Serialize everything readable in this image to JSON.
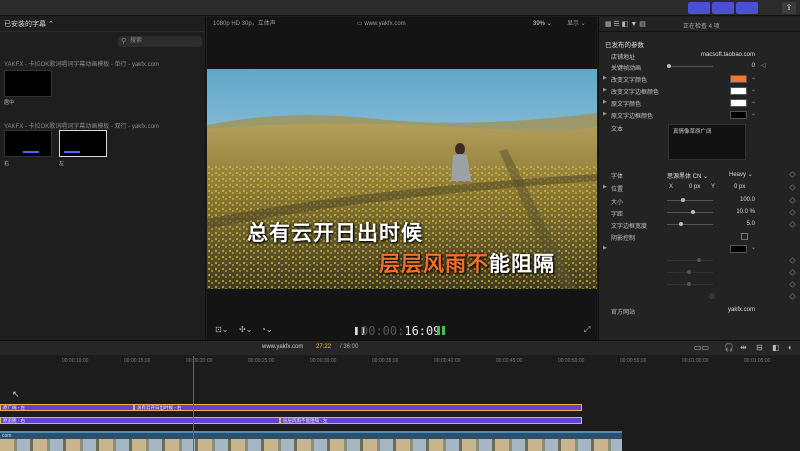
{
  "browser": {
    "header": "已安装的字幕",
    "search_placeholder": "搜索",
    "group1": "YAKFX - 卡拉OK歌词唱词字幕动画模板 - 单行 - yakfx.com",
    "group1_item": "居中",
    "group2": "YAKFX - 卡拉OK歌词唱词字幕动画模板 - 双行 - yakfx.com",
    "group2_items": [
      "右",
      "左"
    ]
  },
  "viewer": {
    "format": "1080p HD 30p，立体声",
    "site": "www.yakfx.com",
    "zoom": "39%",
    "display": "显示",
    "subtitle_line1": "总有云开日出时候",
    "subtitle_line2_highlight": "层层风雨不",
    "subtitle_line2_rest": "能阻隔",
    "timecode_dim": "00:00:",
    "timecode": "16:09"
  },
  "inspector": {
    "header": "正在检查 4 项",
    "section": "已发布的参数",
    "rows": [
      {
        "label": "店铺地址",
        "value": "macsoft.taobao.com"
      },
      {
        "label": "关键帧动画",
        "value": "0"
      },
      {
        "label": "改变文字颜色",
        "color": "#f07a2a"
      },
      {
        "label": "改变文字边框颜色",
        "color": "#ffffff"
      },
      {
        "label": "原文字颜色",
        "color": "#ffffff"
      },
      {
        "label": "原文字边框颜色",
        "color": "#000000"
      }
    ],
    "text_label": "文本",
    "text_value": "真情像草原广阔",
    "font_label": "字体",
    "font_value": "思源黑体 CN",
    "font_weight": "Heavy",
    "position_label": "位置",
    "pos_x_label": "X",
    "pos_x": "0",
    "pos_y_label": "Y",
    "pos_y": "0",
    "pos_unit": "px",
    "size_label": "大小",
    "size_value": "100.0",
    "spacing_label": "字距",
    "spacing_value": "10.0 %",
    "border_label": "文字边框宽度",
    "border_value": "5.0",
    "shadow_label": "阴影控制",
    "official_label": "官方网站",
    "official_value": "yakfx.com"
  },
  "timeline": {
    "site": "www.yakfx.com",
    "time": "27:22",
    "duration": "/ 36:00",
    "ticks": [
      "00:00:10:00",
      "00:00:15:00",
      "00:00:20:00",
      "00:00:25:00",
      "00:00:30:00",
      "00:00:35:00",
      "00:00:40:00",
      "00:00:45:00",
      "00:00:50:00",
      "00:00:55:00",
      "00:01:00:00",
      "00:01:05:00"
    ],
    "clips": [
      "原广阔 - 左",
      "总有云开日出时候 - 右",
      "原追随 - 右",
      "层层风雨不能阻隔 - 左"
    ],
    "video_clip": "com"
  }
}
